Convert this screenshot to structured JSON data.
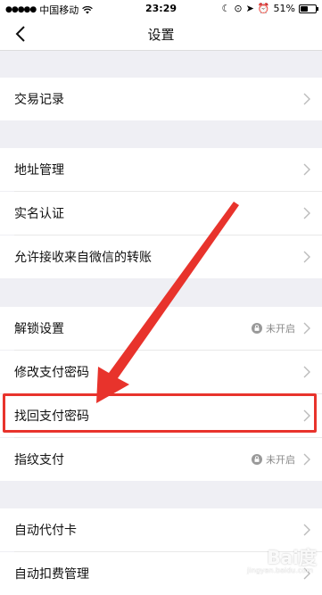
{
  "status_bar": {
    "carrier": "中国移动",
    "time": "23:29",
    "battery": "51%",
    "battery_level": 0.51
  },
  "nav": {
    "title": "设置",
    "back_icon": "chevron-left-icon"
  },
  "rows": [
    {
      "label": "交易记录"
    },
    {
      "label": "地址管理"
    },
    {
      "label": "实名认证"
    },
    {
      "label": "允许接收来自微信的转账"
    },
    {
      "label": "解锁设置",
      "status": "未开启"
    },
    {
      "label": "修改支付密码"
    },
    {
      "label": "找回支付密码"
    },
    {
      "label": "指纹支付",
      "status": "未开启"
    },
    {
      "label": "自动代付卡"
    },
    {
      "label": "自动扣费管理"
    }
  ],
  "annotation": {
    "color": "#e8332c"
  },
  "watermark": {
    "text": "Bai度",
    "sub": "jingyan.baidu.com"
  }
}
